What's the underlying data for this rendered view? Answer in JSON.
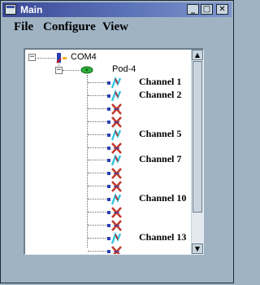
{
  "window": {
    "title": "Main",
    "minimize_glyph": "_",
    "maximize_glyph": "□",
    "close_glyph": "✕"
  },
  "menu": {
    "items": [
      {
        "label": "File"
      },
      {
        "label": "Configure"
      },
      {
        "label": "View"
      }
    ]
  },
  "tree": {
    "root": {
      "label": "COM4",
      "expander": "−"
    },
    "pod": {
      "label": "Pod-4",
      "expander": "−"
    },
    "channels": [
      {
        "status": "active",
        "label": "Channel 1"
      },
      {
        "status": "active",
        "label": "Channel 2"
      },
      {
        "status": "disabled",
        "label": ""
      },
      {
        "status": "disabled",
        "label": ""
      },
      {
        "status": "active",
        "label": "Channel 5"
      },
      {
        "status": "disabled",
        "label": ""
      },
      {
        "status": "active",
        "label": "Channel 7"
      },
      {
        "status": "disabled",
        "label": ""
      },
      {
        "status": "disabled",
        "label": ""
      },
      {
        "status": "active",
        "label": "Channel 10"
      },
      {
        "status": "disabled",
        "label": ""
      },
      {
        "status": "disabled",
        "label": ""
      },
      {
        "status": "active",
        "label": "Channel 13"
      },
      {
        "status": "disabled",
        "label": ""
      }
    ]
  },
  "scrollbar": {
    "up_glyph": "▲",
    "down_glyph": "▼"
  },
  "colors": {
    "title_bar_start": "#3b4896",
    "window_bg": "#9fb3c3",
    "active_channel": "#39c6e0",
    "disabled_channel": "#c0392b"
  }
}
